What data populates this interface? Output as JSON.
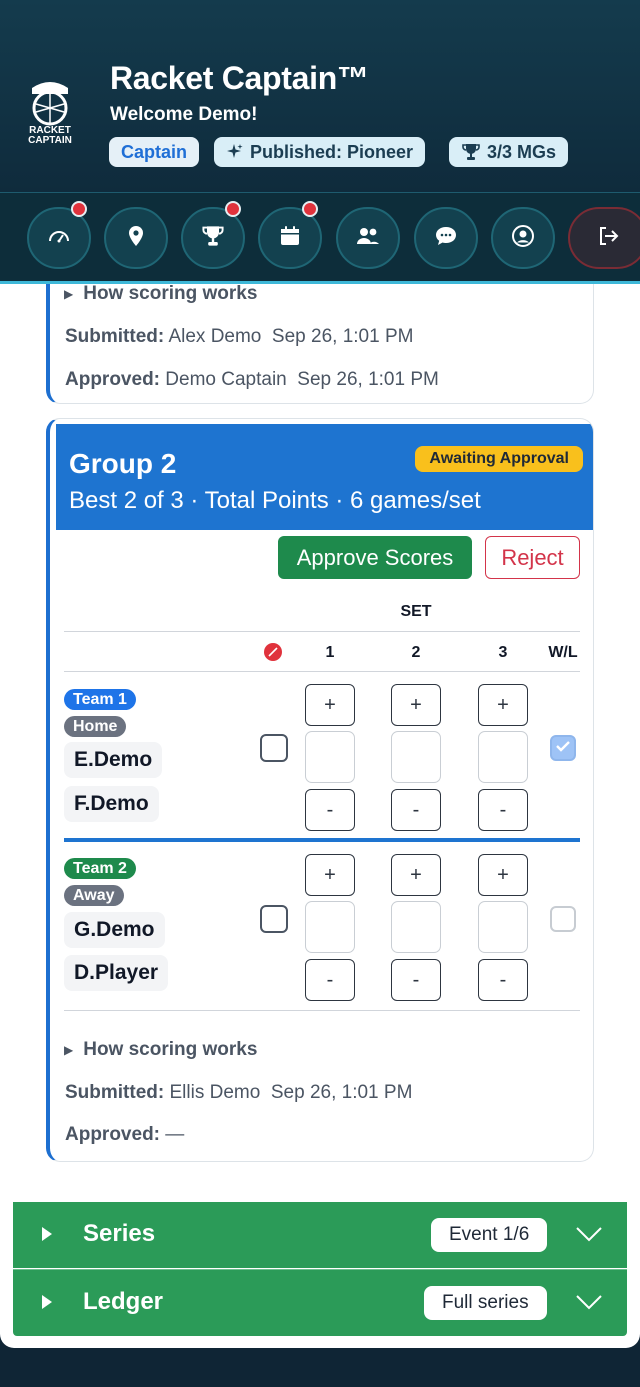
{
  "header": {
    "app_title": "Racket Captain™",
    "welcome": "Welcome Demo!",
    "logo_text_line1": "RACKET",
    "logo_text_line2": "CAPTAIN",
    "chips": {
      "captain": "Captain",
      "published": "Published: Pioneer",
      "mgs": "3/3 MGs"
    },
    "chip_icons": [
      "sparkle-icon",
      "trophy-icon"
    ]
  },
  "nav": {
    "items": [
      {
        "icon": "dashboard-icon",
        "badge": true
      },
      {
        "icon": "location-pin-icon",
        "badge": false
      },
      {
        "icon": "trophy-icon",
        "badge": true
      },
      {
        "icon": "calendar-icon",
        "badge": true
      },
      {
        "icon": "people-icon",
        "badge": false
      },
      {
        "icon": "chat-icon",
        "badge": false
      },
      {
        "icon": "profile-icon",
        "badge": false
      },
      {
        "icon": "logout-icon",
        "badge": false
      }
    ]
  },
  "group1": {
    "how_scoring": "How scoring works",
    "submitted_label": "Submitted:",
    "submitted_value": "Alex Demo  Sep 26, 1:01 PM",
    "approved_label": "Approved:",
    "approved_value": "Demo Captain  Sep 26, 1:01 PM"
  },
  "group2": {
    "title": "Group 2",
    "subtitle": "Best 2 of 3 · Total Points · 6 games/set",
    "status_badge": "Awaiting Approval",
    "approve_label": "Approve Scores",
    "reject_label": "Reject",
    "set_label": "SET",
    "columns": [
      "1",
      "2",
      "3",
      "W/L"
    ],
    "plus": "+",
    "minus": "-",
    "teams": [
      {
        "label": "Team 1",
        "side": "Home",
        "players": [
          "E.Demo",
          "F.Demo"
        ],
        "forfeit_checked": false,
        "win": true,
        "scores": [
          "",
          "",
          ""
        ]
      },
      {
        "label": "Team 2",
        "side": "Away",
        "players": [
          "G.Demo",
          "D.Player"
        ],
        "forfeit_checked": false,
        "win": false,
        "scores": [
          "",
          "",
          ""
        ]
      }
    ],
    "how_scoring": "How scoring works",
    "submitted_label": "Submitted:",
    "submitted_value": "Ellis Demo  Sep 26, 1:01 PM",
    "approved_label": "Approved:",
    "approved_value": "—"
  },
  "accordions": [
    {
      "label": "Series",
      "pill": "Event 1/6"
    },
    {
      "label": "Ledger",
      "pill": "Full series"
    }
  ],
  "colors": {
    "header_bg": "#143b4d",
    "accent_blue": "#1e74d0",
    "approve_green": "#1e8a4c",
    "reject_red": "#d3344a",
    "awaiting_yellow": "#f9c01c",
    "accordion_green": "#2b9b58"
  }
}
